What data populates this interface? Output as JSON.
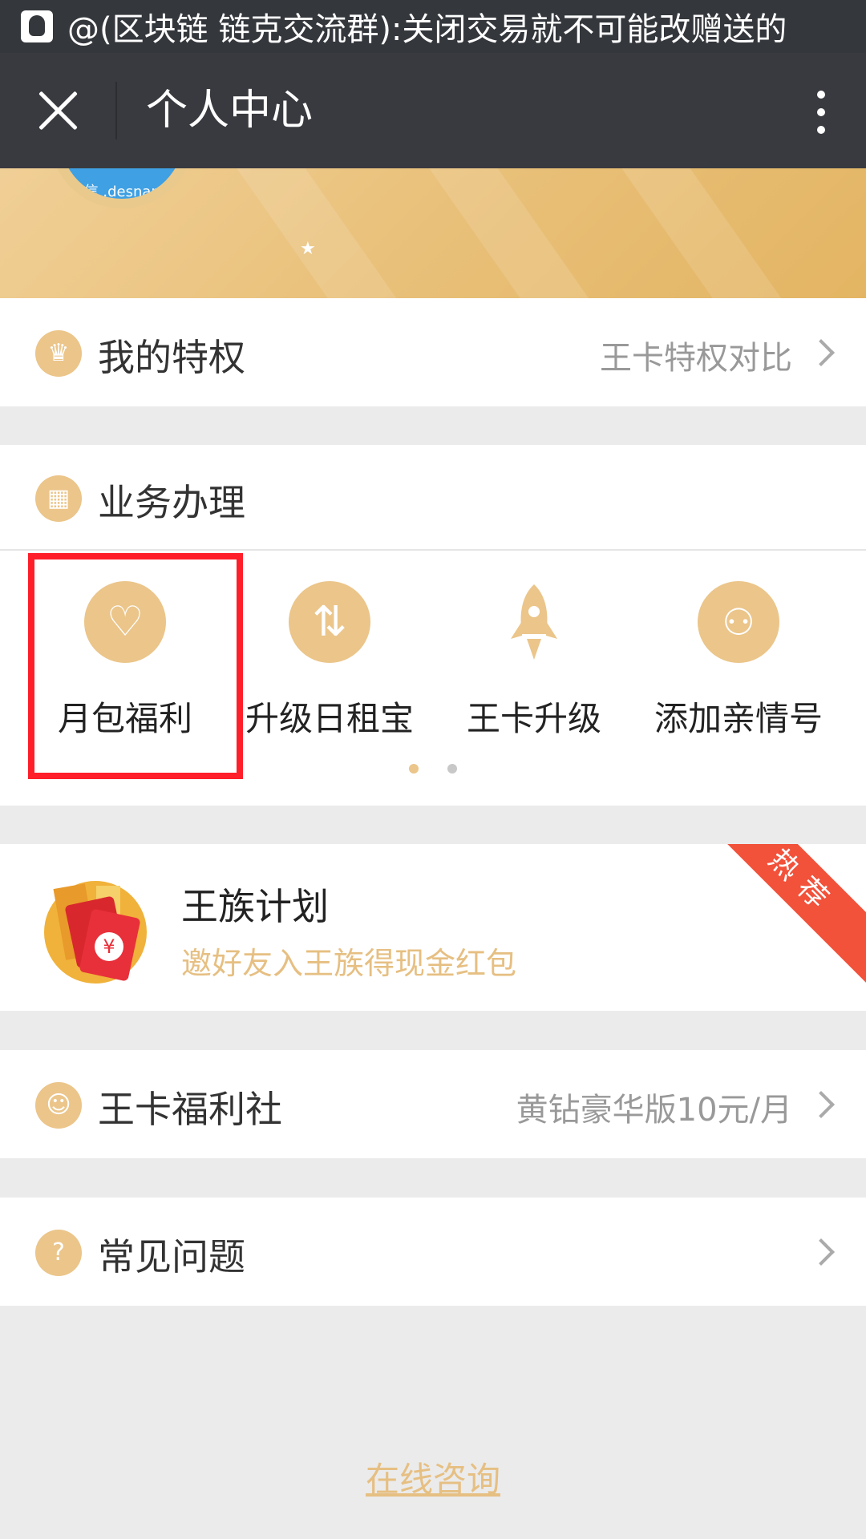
{
  "notification": {
    "text": "@(区块链 链克交流群):关闭交易就不可能改赠送的"
  },
  "appbar": {
    "title": "个人中心"
  },
  "banner": {
    "avatar_text": "成信 .desnank]"
  },
  "privilege": {
    "label": "我的特权",
    "right_text": "王卡特权对比"
  },
  "services": {
    "label": "业务办理",
    "items": [
      {
        "label": "月包福利",
        "icon": "heart-icon"
      },
      {
        "label": "升级日租宝",
        "icon": "swap-arrows-icon"
      },
      {
        "label": "王卡升级",
        "icon": "rocket-icon"
      },
      {
        "label": "添加亲情号",
        "icon": "add-users-icon"
      }
    ],
    "page_dots": 2,
    "active_dot": 0
  },
  "promo": {
    "title": "王族计划",
    "subtitle": "邀好友入王族得现金红包",
    "ribbon": "热荐",
    "yen": "¥"
  },
  "welfare": {
    "label": "王卡福利社",
    "right_text": "黄钻豪华版10元/月"
  },
  "faq": {
    "label": "常见问题"
  },
  "footer": {
    "link": "在线咨询"
  },
  "colors": {
    "accent": "#ebc58a",
    "highlight": "#ff1f2a",
    "ribbon": "#f2513a",
    "appbar": "#393a3f"
  }
}
